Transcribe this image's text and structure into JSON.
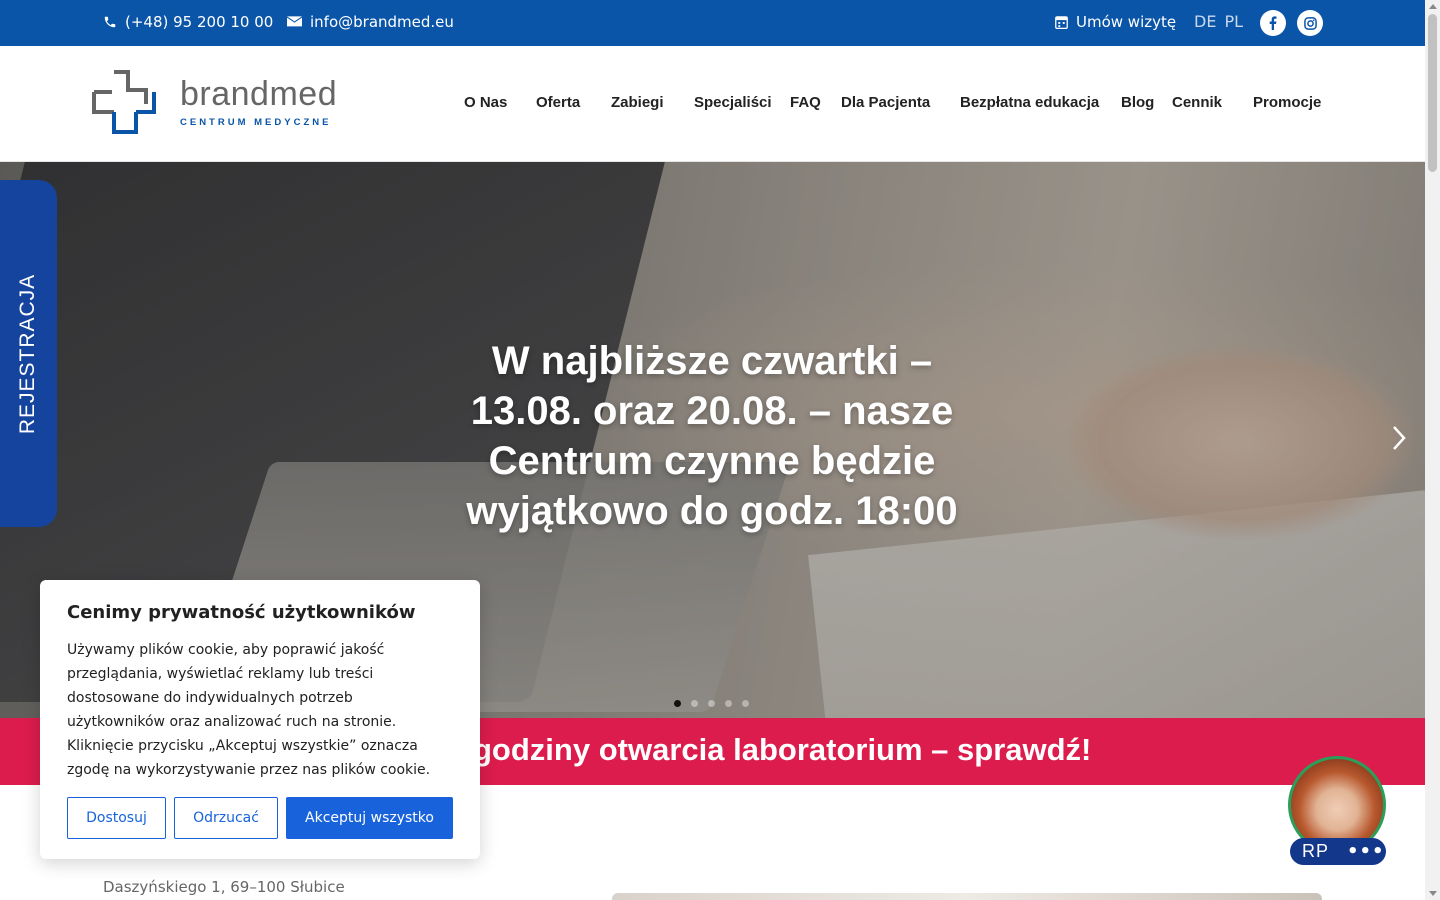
{
  "topbar": {
    "phone": "(+48) 95 200 10 00",
    "email": "info@brandmed.eu",
    "appointment": "Umów wizytę",
    "languages": [
      "DE",
      "PL"
    ],
    "social": [
      "facebook-icon",
      "instagram-icon"
    ],
    "bg_color": "#0a55a8"
  },
  "brand": {
    "name": "brandmed",
    "tagline": "CENTRUM MEDYCZNE"
  },
  "nav": [
    "O Nas",
    "Oferta",
    "Zabiegi",
    "Specjaliści",
    "FAQ",
    "Dla Pacjenta",
    "Bezpłatna edukacja",
    "Blog",
    "Cennik",
    "Promocje"
  ],
  "hero": {
    "title": "W najbliższe czwartki – 13.08. oraz 20.08. – nasze Centrum czynne będzie wyjątkowo do godz. 18:00",
    "slides_total": 5,
    "active_slide": 1
  },
  "side_tab": "REJESTRACJA",
  "banner": {
    "text": "godziny otwarcia laboratorium – sprawdź!",
    "color": "#dc1c4c"
  },
  "address": "Daszyńskiego 1, 69–100 Słubice",
  "cookie": {
    "title": "Cenimy prywatność użytkowników",
    "body": "Używamy plików cookie, aby poprawić jakość przeglądania, wyświetlać reklamy lub treści dostosowane do indywidualnych potrzeb użytkowników oraz analizować ruch na stronie. Kliknięcie przycisku „Akceptuj wszystkie” oznacza zgodę na wykorzystywanie przez nas plików cookie.",
    "customize": "Dostosuj",
    "reject": "Odrzucać",
    "accept": "Akceptuj wszystko",
    "accent": "#1863dc"
  },
  "chat": {
    "label": "RP",
    "more": "•••"
  }
}
